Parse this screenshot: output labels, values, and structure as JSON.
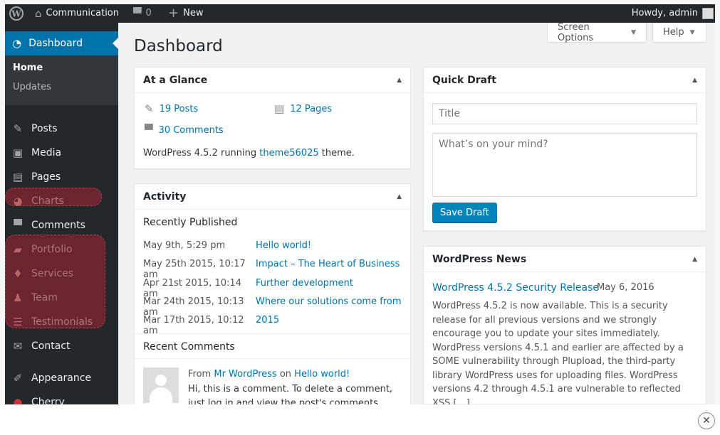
{
  "adminbar": {
    "site_name": "Communication",
    "comments_count": "0",
    "new_label": "New",
    "howdy": "Howdy, admin"
  },
  "sidebar": {
    "current": "Dashboard",
    "submenu": [
      "Home",
      "Updates"
    ],
    "items": [
      {
        "label": "Posts",
        "icon": "pin-icon"
      },
      {
        "label": "Media",
        "icon": "media-icon"
      },
      {
        "label": "Pages",
        "icon": "pages-icon"
      },
      {
        "label": "Charts",
        "icon": "pie-chart-icon"
      },
      {
        "label": "Comments",
        "icon": "comment-icon"
      },
      {
        "label": "Portfolio",
        "icon": "folder-icon"
      },
      {
        "label": "Services",
        "icon": "lightbulb-icon"
      },
      {
        "label": "Team",
        "icon": "team-icon"
      },
      {
        "label": "Testimonials",
        "icon": "quote-icon"
      },
      {
        "label": "Contact",
        "icon": "mail-icon"
      },
      {
        "label": "Appearance",
        "icon": "brush-icon"
      },
      {
        "label": "Cherry",
        "icon": "cherry-icon"
      }
    ]
  },
  "header": {
    "title": "Dashboard",
    "screen_options": "Screen Options",
    "help": "Help"
  },
  "glance": {
    "title": "At a Glance",
    "posts": "19 Posts",
    "pages": "12 Pages",
    "comments": "30 Comments",
    "running_prefix": "WordPress 4.5.2 running ",
    "theme": "theme56025",
    "running_suffix": " theme."
  },
  "activity": {
    "title": "Activity",
    "recently_published": "Recently Published",
    "rows": [
      {
        "date": "May 9th, 5:29 pm",
        "post": "Hello world!"
      },
      {
        "date": "May 25th 2015, 10:17 am",
        "post": "Impact – The Heart of Business"
      },
      {
        "date": "Apr 21st 2015, 10:14 am",
        "post": "Further development"
      },
      {
        "date": "Mar 24th 2015, 10:13 am",
        "post": "Where our solutions come from"
      },
      {
        "date": "Mar 17th 2015, 10:12 am",
        "post": "2015"
      }
    ],
    "recent_comments": "Recent Comments",
    "comment_from": "From",
    "comment_author": "Mr WordPress",
    "comment_on": "on",
    "comment_post": "Hello world!",
    "comment_text": "Hi, this is a comment. To delete a comment, just log in and view the post's comments. There you"
  },
  "quick_draft": {
    "title": "Quick Draft",
    "title_placeholder": "Title",
    "content_placeholder": "What’s on your mind?",
    "save_label": "Save Draft"
  },
  "news": {
    "title": "WordPress News",
    "item_title": "WordPress 4.5.2 Security Release",
    "item_date": "May 6, 2016",
    "item_body": "WordPress 4.5.2 is now available. This is a security release for all previous versions and we strongly encourage you to update your sites immediately. WordPress versions 4.5.1 and earlier are affected by a SOME vulnerability through Plupload, the third-party library WordPress uses for uploading files. WordPress versions 4.2 through 4.5.1 are vulnerable to reflected XSS […]"
  },
  "colors": {
    "accent": "#0073aa",
    "sidebar_bg": "#23282d",
    "highlight": "#6b2530"
  }
}
